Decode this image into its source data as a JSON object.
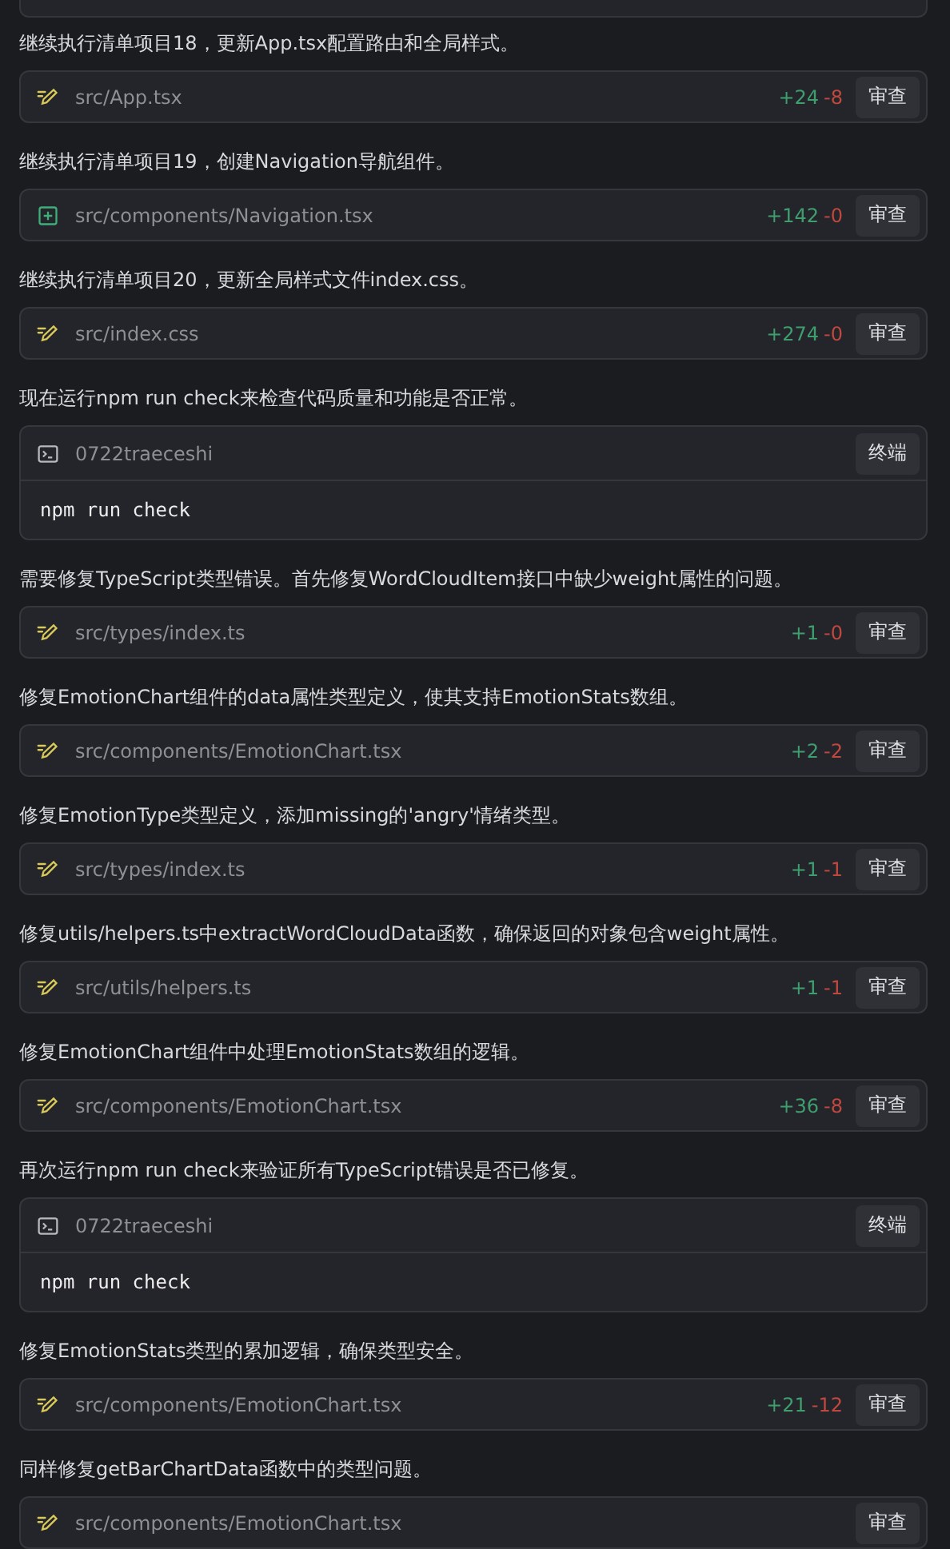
{
  "steps": [
    {
      "message": "继续执行清单项目18，更新App.tsx配置路由和全局样式。",
      "kind": "file",
      "file": {
        "path": "src/App.tsx",
        "added": "+24",
        "removed": "-8",
        "action": "审查"
      }
    },
    {
      "message": "继续执行清单项目19，创建Navigation导航组件。",
      "kind": "new_file",
      "file": {
        "path": "src/components/Navigation.tsx",
        "added": "+142",
        "removed": "-0",
        "action": "审查"
      }
    },
    {
      "message": "继续执行清单项目20，更新全局样式文件index.css。",
      "kind": "file",
      "file": {
        "path": "src/index.css",
        "added": "+274",
        "removed": "-0",
        "action": "审查"
      }
    },
    {
      "message": "现在运行npm run check来检查代码质量和功能是否正常。",
      "kind": "terminal",
      "terminal": {
        "name": "0722traeceshi",
        "action": "终端",
        "command": "npm run check"
      }
    },
    {
      "message": "需要修复TypeScript类型错误。首先修复WordCloudItem接口中缺少weight属性的问题。",
      "kind": "file",
      "file": {
        "path": "src/types/index.ts",
        "added": "+1",
        "removed": "-0",
        "action": "审查"
      }
    },
    {
      "message": "修复EmotionChart组件的data属性类型定义，使其支持EmotionStats数组。",
      "kind": "file",
      "file": {
        "path": "src/components/EmotionChart.tsx",
        "added": "+2",
        "removed": "-2",
        "action": "审查"
      }
    },
    {
      "message": "修复EmotionType类型定义，添加missing的'angry'情绪类型。",
      "kind": "file",
      "file": {
        "path": "src/types/index.ts",
        "added": "+1",
        "removed": "-1",
        "action": "审查"
      }
    },
    {
      "message": "修复utils/helpers.ts中extractWordCloudData函数，确保返回的对象包含weight属性。",
      "kind": "file",
      "file": {
        "path": "src/utils/helpers.ts",
        "added": "+1",
        "removed": "-1",
        "action": "审查"
      }
    },
    {
      "message": "修复EmotionChart组件中处理EmotionStats数组的逻辑。",
      "kind": "file",
      "file": {
        "path": "src/components/EmotionChart.tsx",
        "added": "+36",
        "removed": "-8",
        "action": "审查"
      }
    },
    {
      "message": "再次运行npm run check来验证所有TypeScript错误是否已修复。",
      "kind": "terminal",
      "terminal": {
        "name": "0722traeceshi",
        "action": "终端",
        "command": "npm run check"
      }
    },
    {
      "message": "修复EmotionStats类型的累加逻辑，确保类型安全。",
      "kind": "file",
      "file": {
        "path": "src/components/EmotionChart.tsx",
        "added": "+21",
        "removed": "-12",
        "action": "审查"
      }
    },
    {
      "message": "同样修复getBarChartData函数中的类型问题。",
      "kind": "file",
      "file": {
        "path": "src/components/EmotionChart.tsx",
        "action": "审查"
      }
    }
  ]
}
